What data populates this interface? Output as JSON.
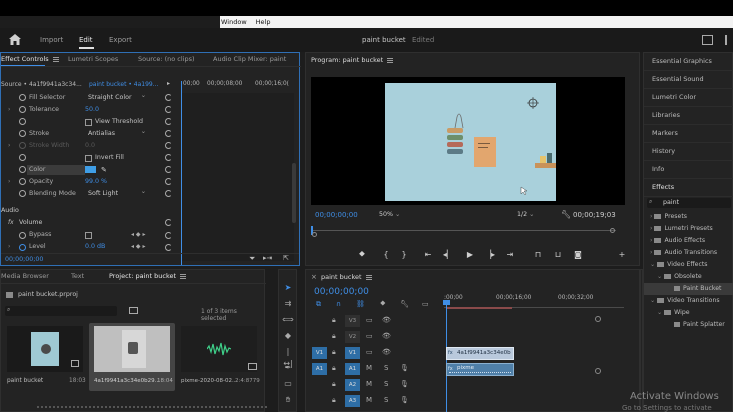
{
  "menubar": {
    "window_label": "Window",
    "help_label": "Help"
  },
  "header": {
    "tabs": [
      {
        "label": "Import",
        "active": false
      },
      {
        "label": "Edit",
        "active": true
      },
      {
        "label": "Export",
        "active": false
      }
    ],
    "project_name": "paint bucket",
    "project_status": "Edited"
  },
  "effect_controls": {
    "tabs": [
      {
        "label": "Effect Controls",
        "active": true
      },
      {
        "label": "Lumetri Scopes",
        "active": false
      },
      {
        "label": "Source: (no clips)",
        "active": false
      },
      {
        "label": "Audio Clip Mixer: paint",
        "active": false
      }
    ],
    "source_label": "Source • 4a1f9941a3c34...",
    "clip_label": "paint bucket • 4a199...",
    "ruler": [
      "00;00",
      "00;00;08;00",
      "00;00;16;0("
    ],
    "rows": [
      {
        "label": "Fill Selector",
        "value": "Straight Color",
        "type": "dropdown"
      },
      {
        "label": "Tolerance",
        "value": "50.0",
        "type": "number"
      },
      {
        "label": "",
        "value": "View Threshold",
        "type": "checkbox"
      },
      {
        "label": "Stroke",
        "value": "Antialias",
        "type": "dropdown"
      },
      {
        "label": "Stroke Width",
        "value": "0.0",
        "type": "dim"
      },
      {
        "label": "",
        "value": "Invert Fill",
        "type": "checkbox"
      },
      {
        "label": "Color",
        "value": "",
        "type": "color"
      },
      {
        "label": "Opacity",
        "value": "99.0 %",
        "type": "number"
      },
      {
        "label": "Blending Mode",
        "value": "Soft Light",
        "type": "dropdown"
      }
    ],
    "audio_label": "Audio",
    "volume_label": "Volume",
    "bypass_label": "Bypass",
    "level_label": "Level",
    "level_value": "0.0 dB",
    "timecode": "00;00;00;00"
  },
  "program": {
    "title": "Program: paint bucket",
    "timecode_left": "00;00;00;00",
    "zoom": "50%",
    "quality": "1/2",
    "timecode_right": "00;00;19;03"
  },
  "right_panel": {
    "items": [
      "Essential Graphics",
      "Essential Sound",
      "Lumetri Color",
      "Libraries",
      "Markers",
      "History",
      "Info",
      "Effects"
    ],
    "search_value": "paint",
    "tree": [
      {
        "label": "Presets",
        "indent": 0
      },
      {
        "label": "Lumetri Presets",
        "indent": 0
      },
      {
        "label": "Audio Effects",
        "indent": 0
      },
      {
        "label": "Audio Transitions",
        "indent": 0
      },
      {
        "label": "Video Effects",
        "indent": 0
      },
      {
        "label": "Obsolete",
        "indent": 1
      },
      {
        "label": "Paint Bucket",
        "indent": 2
      },
      {
        "label": "Video Transitions",
        "indent": 0
      },
      {
        "label": "Wipe",
        "indent": 1
      },
      {
        "label": "Paint Splatter",
        "indent": 2
      }
    ]
  },
  "project_panel": {
    "tabs": [
      {
        "label": "Media Browser",
        "active": false
      },
      {
        "label": "Text",
        "active": false
      },
      {
        "label": "Project: paint bucket",
        "active": true
      }
    ],
    "file_name": "paint bucket.prproj",
    "selection_info": "1 of 3 items selected",
    "items": [
      {
        "name": "paint bucket",
        "duration": "18:03"
      },
      {
        "name": "4a1f9941a3c34e0b29...",
        "duration": "18:04"
      },
      {
        "name": "pixme-2020-08-02...",
        "duration": "2:4:8779"
      }
    ]
  },
  "timeline": {
    "title": "paint bucket",
    "timecode": "00;00;00;00",
    "ruler": [
      ":00;00",
      "00;00;16;00",
      "00;00;32;00"
    ],
    "tracks": [
      {
        "src": "",
        "name": "V3",
        "kind": "video"
      },
      {
        "src": "",
        "name": "V2",
        "kind": "video"
      },
      {
        "src": "V1",
        "name": "V1",
        "kind": "video"
      },
      {
        "src": "A1",
        "name": "A1",
        "kind": "audio"
      },
      {
        "src": "",
        "name": "A2",
        "kind": "audio"
      },
      {
        "src": "",
        "name": "A3",
        "kind": "audio"
      }
    ],
    "video_clip_label": "4a1f9941a3c34e0b",
    "audio_clip_label": "pixme"
  },
  "watermark": {
    "title": "Activate Windows",
    "subtitle": "Go to Settings to activate"
  },
  "colors": {
    "accent_blue": "#3f8ee6",
    "track_blue": "#2e6ea6",
    "video_clip": "#b9c9dc",
    "audio_clip": "#4f7fa8",
    "video_bg": "#aacfdc"
  }
}
